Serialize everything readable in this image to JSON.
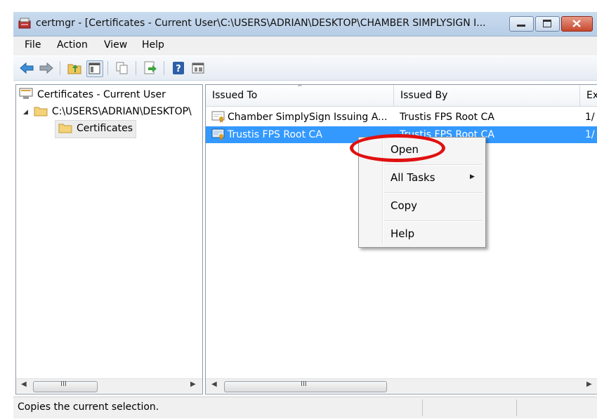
{
  "window": {
    "title": "certmgr - [Certificates - Current User\\C:\\USERS\\ADRIAN\\DESKTOP\\CHAMBER SIMPLYSIGN I...",
    "buttons": [
      "minimize",
      "maximize",
      "close"
    ]
  },
  "menubar": {
    "items": [
      "File",
      "Action",
      "View",
      "Help"
    ]
  },
  "toolbar": {
    "icons": [
      "back-arrow-icon",
      "forward-arrow-icon",
      "up-folder-icon",
      "show-hide-tree-icon",
      "copy-icon",
      "export-list-icon",
      "help-icon",
      "properties-icon"
    ]
  },
  "tree": {
    "root": "Certificates - Current User",
    "child": "C:\\USERS\\ADRIAN\\DESKTOP\\",
    "leaf": "Certificates"
  },
  "list": {
    "columns": [
      "Issued To",
      "Issued By",
      "Ex"
    ],
    "rows": [
      {
        "issued_to": "Chamber SimplySign Issuing A...",
        "issued_by": "Trustis FPS Root CA",
        "expires": "1/"
      },
      {
        "issued_to": "Trustis FPS Root CA",
        "issued_by": "Trustis FPS Root CA",
        "expires": "1/"
      }
    ]
  },
  "context_menu": {
    "items": [
      "Open",
      "All Tasks",
      "Copy",
      "Help"
    ]
  },
  "status": {
    "text": "Copies the current selection."
  },
  "colors": {
    "selection": "#3399ff",
    "callout": "#e01010"
  }
}
